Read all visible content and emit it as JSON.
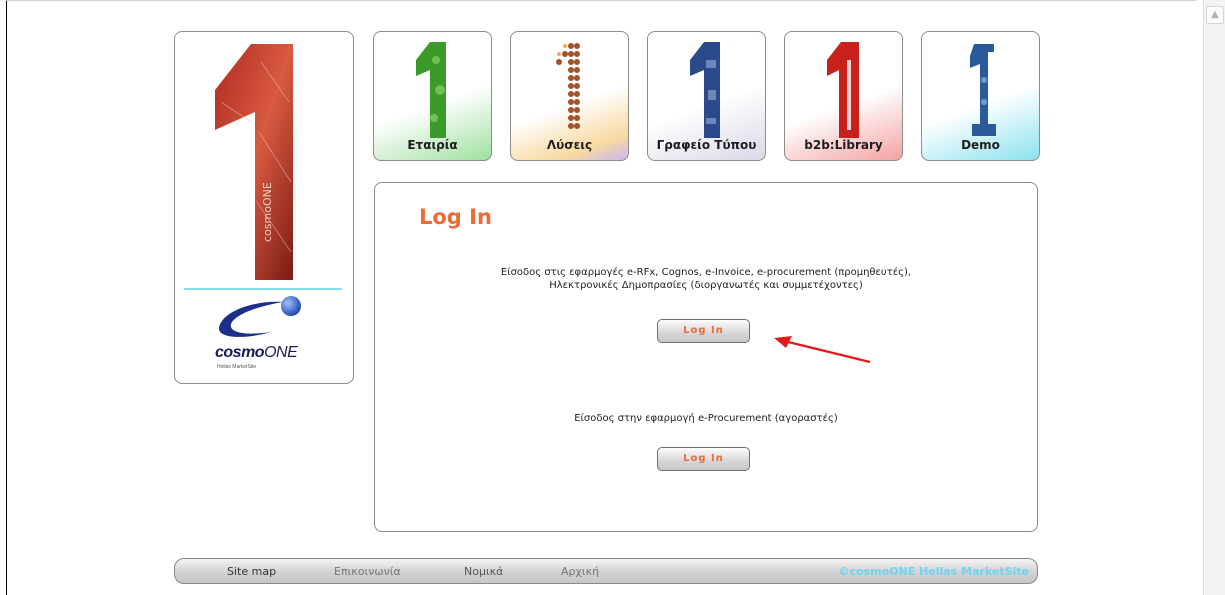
{
  "tiles": [
    {
      "label": "Εταιρία",
      "icon": "number-one-green-icon",
      "color": "#3a9a2a"
    },
    {
      "label": "Λύσεις",
      "icon": "number-one-dots-icon",
      "color": "#a0522d"
    },
    {
      "label": "Γραφείο Τύπου",
      "icon": "number-one-blue-icon",
      "color": "#2a4a8a"
    },
    {
      "label": "b2b:Library",
      "icon": "number-one-red-icon",
      "color": "#c8201a"
    },
    {
      "label": "Demo",
      "icon": "number-one-navy-icon",
      "color": "#2a5a9a"
    }
  ],
  "logo": {
    "brand_bold": "cosmo",
    "brand_normal": "ONE",
    "tagline": "Hellas MarketSite"
  },
  "main": {
    "title": "Log In",
    "section1_line1": "Είσοδος στις εφαρμογές  e-RFx, Cognos, e-Invoice, e-procurement (προμηθευτές),",
    "section1_line2": "Ηλεκτρονικές Δημοπρασίες (διοργανωτές και συμμετέχοντες)",
    "button1": "Log In",
    "section2": "Είσοδος στην εφαρμογή  e-Procurement (αγοραστές)",
    "button2": "Log In"
  },
  "footer": {
    "links": [
      "Site map",
      "Επικοινωνία",
      "Νομικά",
      "Αρχική"
    ],
    "copyright": "©cosmoONE Hellas MarketSite"
  },
  "colors": {
    "accent": "#ee6a37",
    "arrow": "#e41a1a",
    "copyright": "#6fd4f1"
  }
}
